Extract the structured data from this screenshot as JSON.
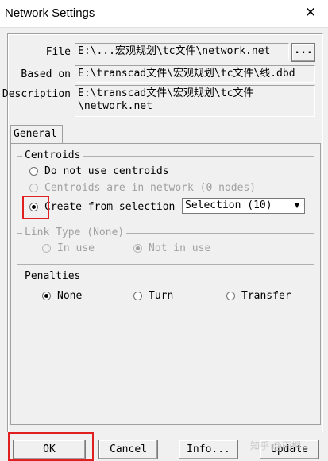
{
  "window": {
    "title": "Network Settings",
    "close_glyph": "✕"
  },
  "fields": {
    "file_label": "File",
    "file_value": "E:\\...宏观规划\\tc文件\\network.net",
    "browse_label": "...",
    "based_on_label": "Based on",
    "based_on_value": "E:\\transcad文件\\宏观规划\\tc文件\\线.dbd",
    "description_label": "Description",
    "description_value": "E:\\transcad文件\\宏观规划\\tc文件\n\\network.net"
  },
  "tabs": {
    "general": "General"
  },
  "centroids": {
    "title": "Centroids",
    "options": [
      {
        "label": "Do not use centroids",
        "selected": false,
        "enabled": true
      },
      {
        "label": "Centroids are in network (0 nodes)",
        "selected": false,
        "enabled": false
      },
      {
        "label": "Create from selection",
        "selected": true,
        "enabled": true
      }
    ],
    "selection_value": "Selection (10)"
  },
  "link_type": {
    "title": "Link Type (None)",
    "options": [
      {
        "label": "In use",
        "selected": false
      },
      {
        "label": "Not in use",
        "selected": true
      }
    ]
  },
  "penalties": {
    "title": "Penalties",
    "options": [
      {
        "label": "None",
        "selected": true
      },
      {
        "label": "Turn",
        "selected": false
      },
      {
        "label": "Transfer",
        "selected": false
      }
    ]
  },
  "buttons": {
    "ok": "OK",
    "cancel": "Cancel",
    "info": "Info...",
    "update": "Update"
  },
  "watermark": "知乎 @雨桐",
  "colors": {
    "highlight": "#e02020"
  }
}
